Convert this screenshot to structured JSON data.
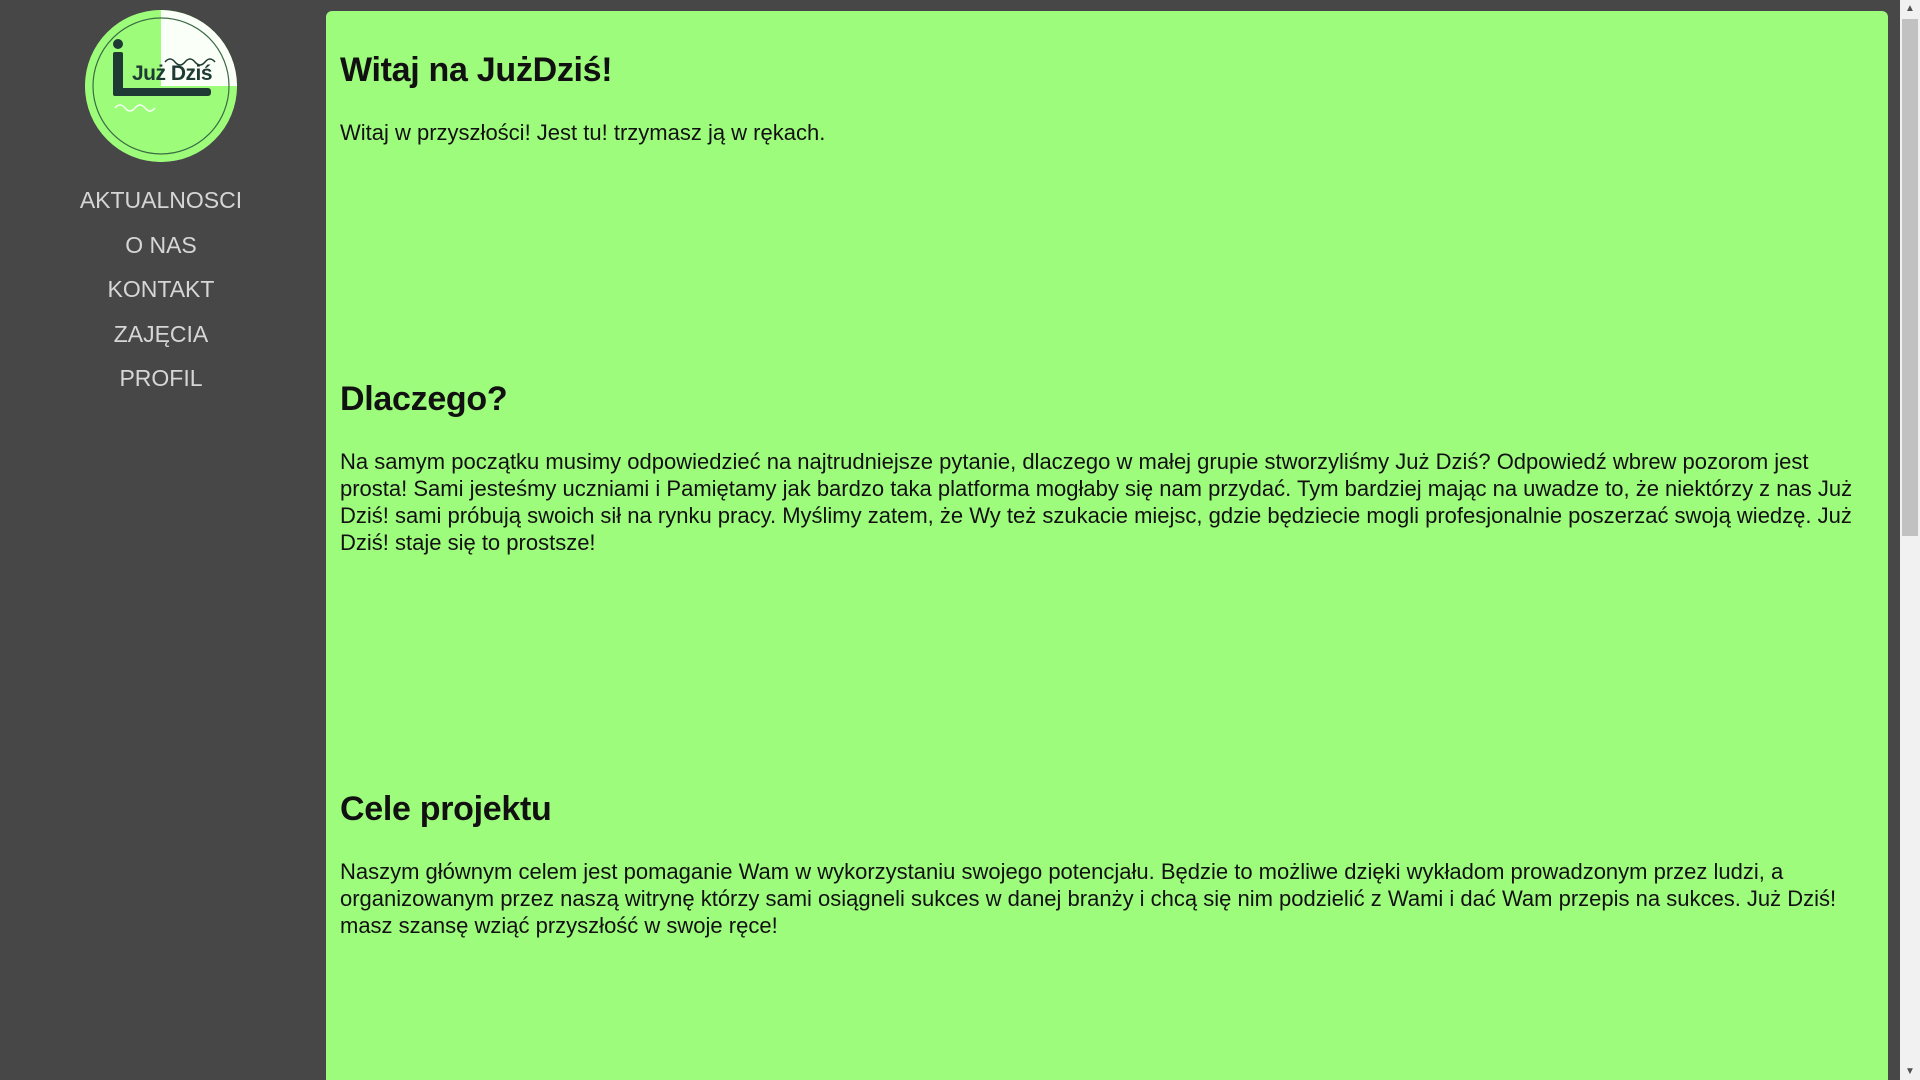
{
  "logo": {
    "text": "Już Dziś",
    "icon": "juz-dzis-logo-icon"
  },
  "nav": {
    "items": [
      {
        "label": "AKTUALNOSCI"
      },
      {
        "label": "O NAS"
      },
      {
        "label": "KONTAKT"
      },
      {
        "label": "ZAJĘCIA"
      },
      {
        "label": "PROFIL"
      }
    ]
  },
  "main": {
    "sections": [
      {
        "heading": "Witaj na JużDziś!",
        "body": "Witaj w przyszłości! Jest tu! trzymasz ją w rękach."
      },
      {
        "heading": "Dlaczego?",
        "body": "Na samym początku musimy odpowiedzieć na najtrudniejsze pytanie, dlaczego w małej grupie stworzyliśmy Już Dziś? Odpowiedź wbrew pozorom jest prosta! Sami jesteśmy uczniami i Pamiętamy jak bardzo taka platforma mogłaby się nam przydać. Tym bardziej mając na uwadze to, że niektórzy z nas Już Dziś! sami próbują swoich sił na rynku pracy. Myślimy zatem, że Wy też szukacie miejsc, gdzie będziecie mogli profesjonalnie poszerzać swoją wiedzę. Już Dziś! staje się to prostsze!"
      },
      {
        "heading": "Cele projektu",
        "body": "Naszym głównym celem jest pomaganie Wam w wykorzystaniu swojego potencjału. Będzie to możliwe dzięki wykładom prowadzonym przez ludzi, a organizowanym przez naszą witrynę którzy sami osiągneli sukces w danej branży i chcą się nim podzielić z Wami i dać Wam przepis na sukces. Już Dziś! masz szansę wziąć przyszłość w swoje ręce!"
      }
    ]
  },
  "colors": {
    "sidebar_bg": "#474747",
    "content_bg": "#9efc7c",
    "nav_text": "#d6d6d6",
    "logo_dark": "#1f3a34"
  },
  "scrollbar": {
    "up_icon": "scroll-up-arrow-icon",
    "down_icon": "scroll-down-arrow-icon"
  }
}
